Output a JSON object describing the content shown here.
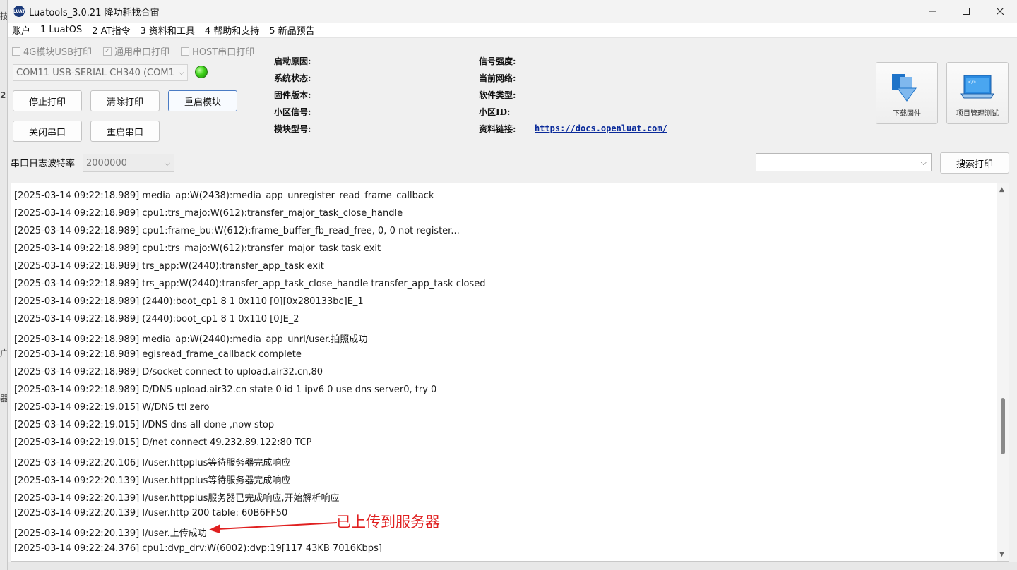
{
  "background_window": {
    "edge_chars": [
      "技",
      "2",
      "广",
      "器"
    ]
  },
  "window": {
    "title": "Luatools_3.0.21 降功耗找合宙",
    "icon_text": "LUAT"
  },
  "menu": [
    "账户",
    "1 LuatOS",
    "2 AT指令",
    "3 资料和工具",
    "4 帮助和支持",
    "5 新品预告"
  ],
  "checkboxes": [
    {
      "label": "4G模块USB打印",
      "checked": false
    },
    {
      "label": "通用串口打印",
      "checked": true
    },
    {
      "label": "HOST串口打印",
      "checked": false
    }
  ],
  "port": {
    "selected": "COM11 USB-SERIAL CH340 (COM1",
    "led_color": "#3fd21a"
  },
  "buttons": {
    "stop_print": "停止打印",
    "clear_print": "清除打印",
    "restart_module": "重启模块",
    "close_port": "关闭串口",
    "restart_port": "重启串口",
    "search_print": "搜索打印"
  },
  "info_left": [
    "启动原因:",
    "系统状态:",
    "固件版本:",
    "小区信号:",
    "模块型号:"
  ],
  "info_right": [
    "信号强度:",
    "当前网络:",
    "软件类型:",
    "小区ID:",
    "资料链接:"
  ],
  "docs_link": "https://docs.openluat.com/",
  "big_buttons": {
    "download_firmware": "下载固件",
    "project_test": "项目管理测试"
  },
  "baud": {
    "label": "串口日志波特率",
    "value": "2000000"
  },
  "log_lines": [
    "[2025-03-14 09:22:18.989] media_ap:W(2438):media_app_unregister_read_frame_callback",
    "[2025-03-14 09:22:18.989] cpu1:trs_majo:W(612):transfer_major_task_close_handle",
    "[2025-03-14 09:22:18.989] cpu1:frame_bu:W(612):frame_buffer_fb_read_free, 0, 0 not register...",
    "[2025-03-14 09:22:18.989] cpu1:trs_majo:W(612):transfer_major_task task exit",
    "[2025-03-14 09:22:18.989] trs_app:W(2440):transfer_app_task exit",
    "[2025-03-14 09:22:18.989] trs_app:W(2440):transfer_app_task_close_handle transfer_app_task closed",
    "[2025-03-14 09:22:18.989] (2440):boot_cp1 8 1 0x110 [0][0x280133bc]E_1",
    "[2025-03-14 09:22:18.989] (2440):boot_cp1 8 1 0x110 [0]E_2",
    "[2025-03-14 09:22:18.989] media_ap:W(2440):media_app_unrl/user.拍照成功",
    "[2025-03-14 09:22:18.989] egisread_frame_callback complete",
    "[2025-03-14 09:22:18.989] D/socket connect to upload.air32.cn,80",
    "[2025-03-14 09:22:18.989] D/DNS upload.air32.cn state 0 id 1 ipv6 0 use dns server0, try 0",
    "[2025-03-14 09:22:19.015] W/DNS ttl zero",
    "[2025-03-14 09:22:19.015] I/DNS dns all done ,now stop",
    "[2025-03-14 09:22:19.015] D/net connect 49.232.89.122:80 TCP",
    "[2025-03-14 09:22:20.106] I/user.httpplus等待服务器完成响应",
    "[2025-03-14 09:22:20.139] I/user.httpplus等待服务器完成响应",
    "[2025-03-14 09:22:20.139] I/user.httpplus服务器已完成响应,开始解析响应",
    "[2025-03-14 09:22:20.139] I/user.http       200       table: 60B6FF50",
    "[2025-03-14 09:22:20.139] I/user.上传成功",
    "[2025-03-14 09:22:24.376] cpu1:dvp_drv:W(6002):dvp:19[117 43KB 7016Kbps]"
  ],
  "annotation": {
    "text": "已上传到服务器",
    "color": "#e02020"
  }
}
